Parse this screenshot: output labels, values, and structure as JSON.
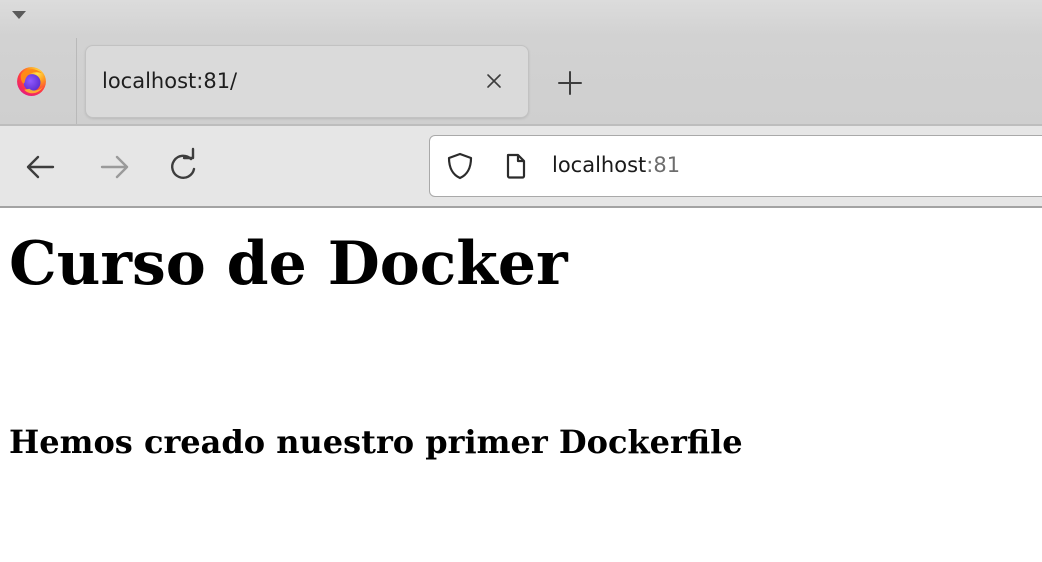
{
  "browser": {
    "tab": {
      "title": "localhost:81/",
      "close_icon": "close-icon"
    },
    "new_tab_icon": "plus-icon",
    "navigation": {
      "back_icon": "arrow-left-icon",
      "forward_icon": "arrow-right-icon",
      "reload_icon": "reload-icon"
    },
    "address_bar": {
      "host": "localhost",
      "port": ":81",
      "security_icon": "shield-icon",
      "page_icon": "page-icon"
    },
    "colors": {
      "chrome": "#d3d3d3",
      "toolbar": "#e6e6e6",
      "icon": "#3d3d3d",
      "icon_disabled": "#9a9a9a"
    }
  },
  "page": {
    "heading": "Curso de Docker",
    "subheading": "Hemos creado nuestro primer Dockerfile"
  }
}
